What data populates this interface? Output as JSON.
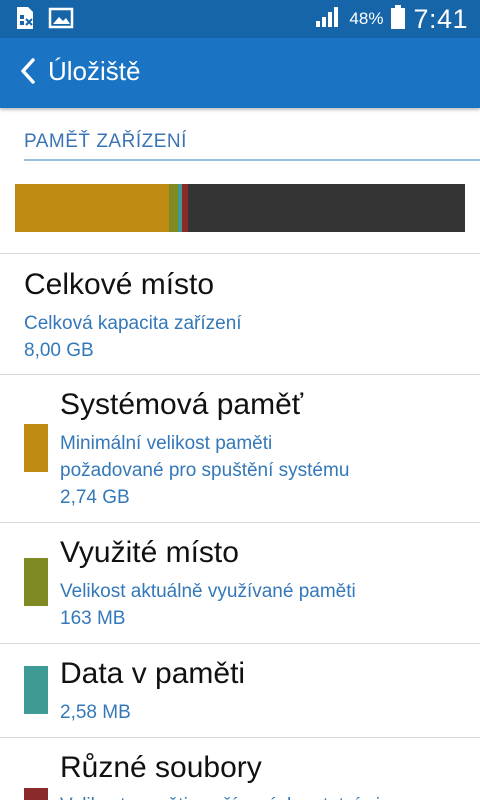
{
  "status_bar": {
    "battery_percent": "48%",
    "time": "7:41"
  },
  "app_bar": {
    "title": "Úložiště"
  },
  "section": {
    "header": "PAMĚŤ ZAŘÍZENÍ"
  },
  "usage_bar": {
    "total_gb": 8.0,
    "segments": [
      {
        "name": "Systémová paměť",
        "value_gb": 2.74,
        "color": "#bf8a12"
      },
      {
        "name": "Využité místo",
        "value_gb": 0.163,
        "color": "#7f8a22"
      },
      {
        "name": "Data v paměti",
        "value_gb": 0.00258,
        "color": "#3e9a95"
      },
      {
        "name": "Různé soubory",
        "value_gb": 0.1,
        "color": "#8a2a2a"
      }
    ],
    "free_color": "#343434"
  },
  "total": {
    "title": "Celkové místo",
    "subtitle": "Celková kapacita zařízení",
    "value": "8,00 GB"
  },
  "items": [
    {
      "title": "Systémová paměť",
      "desc_line1": "Minimální velikost paměti",
      "desc_line2": "požadované pro spuštění systému",
      "value": "2,74 GB",
      "color": "#bf8a12"
    },
    {
      "title": "Využité místo",
      "desc_line1": "Velikost aktuálně využívané paměti",
      "value": "163 MB",
      "color": "#7f8a22"
    },
    {
      "title": "Data v paměti",
      "value": "2,58 MB",
      "color": "#3e9a95"
    },
    {
      "title": "Různé soubory",
      "desc_line1": "Velikost paměti využívaných ostatními",
      "color": "#8a2a2a"
    }
  ]
}
